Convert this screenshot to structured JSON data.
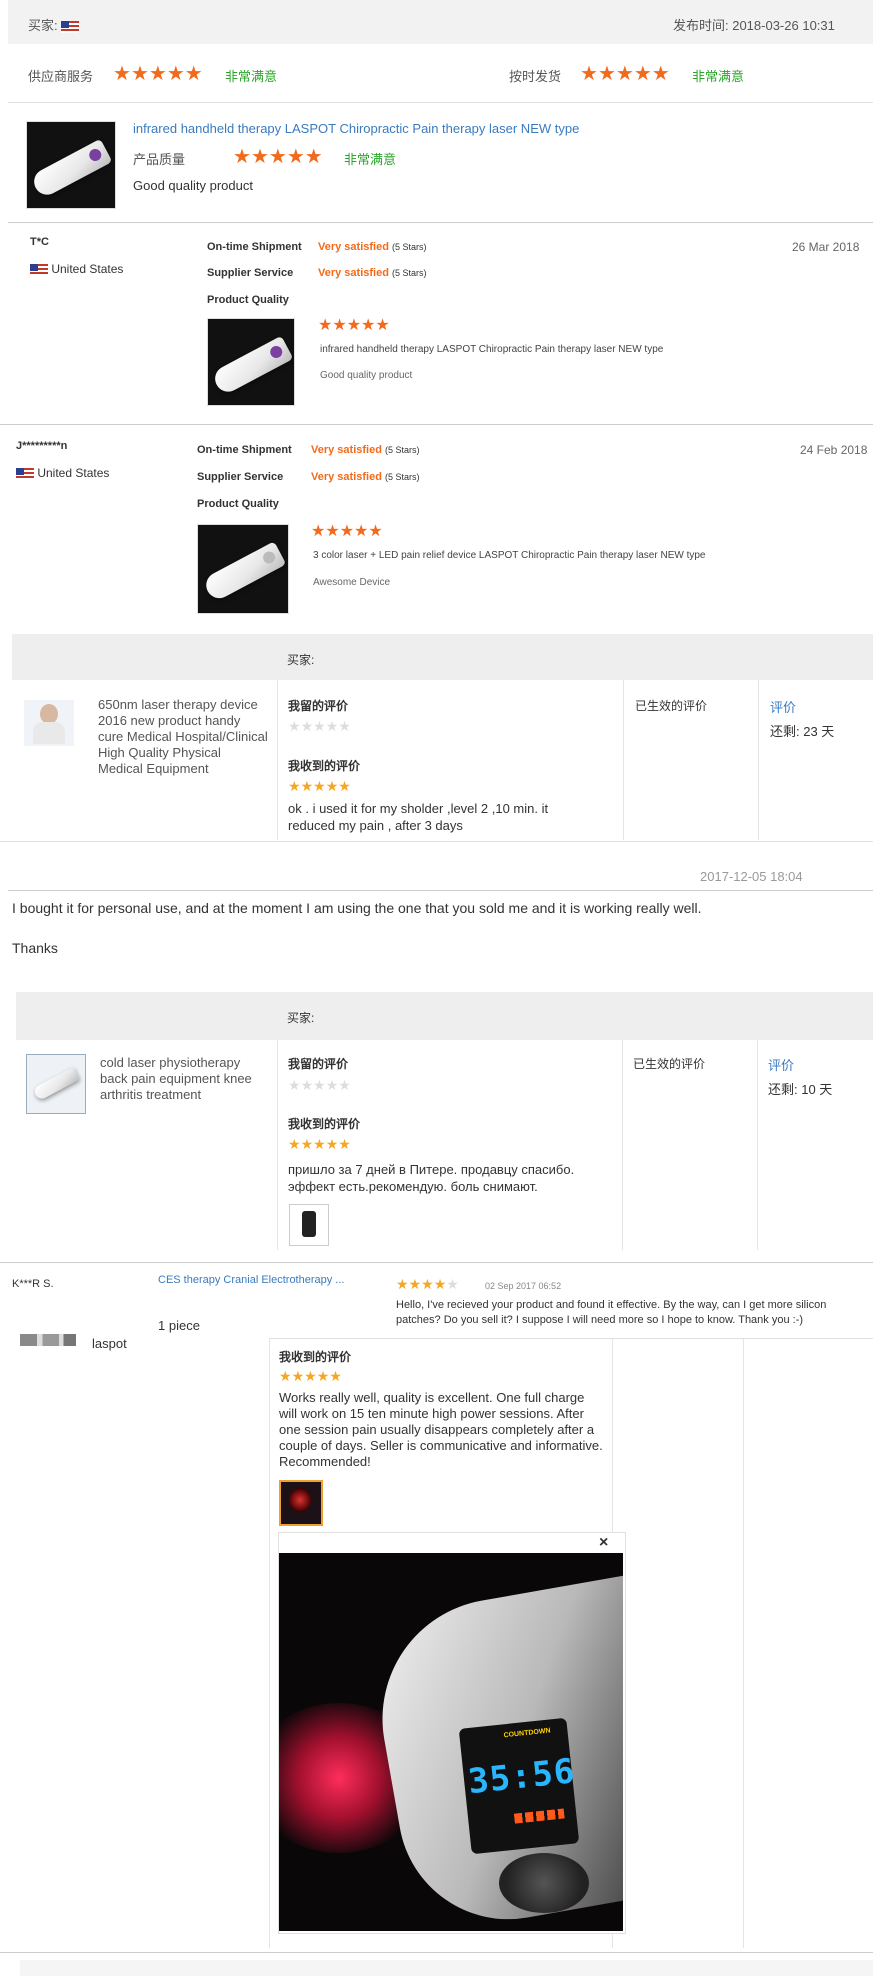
{
  "r1": {
    "buyer_label": "买家:",
    "date": "发布时间: 2018-03-26 10:31",
    "supplier_service": "供应商服务",
    "rating_text": "非常满意",
    "on_time": "按时发货",
    "product_title": "infrared handheld therapy LASPOT Chiropractic Pain therapy laser NEW type",
    "product_quality": "产品质量",
    "comment": "Good quality product"
  },
  "r2": {
    "name": "T*C",
    "country": "United States",
    "date": "26 Mar 2018",
    "on_time_label": "On-time Shipment",
    "supplier_label": "Supplier Service",
    "quality_label": "Product Quality",
    "very_satisfied": "Very satisfied",
    "stars_text": "(5 Stars)",
    "product_title": "infrared handheld therapy LASPOT Chiropractic Pain therapy laser NEW type",
    "comment": "Good quality product"
  },
  "r3": {
    "name": "J*********n",
    "country": "United States",
    "date": "24 Feb 2018",
    "on_time_label": "On-time Shipment",
    "supplier_label": "Supplier Service",
    "quality_label": "Product Quality",
    "very_satisfied": "Very satisfied",
    "stars_text": "(5 Stars)",
    "product_title": "3 color laser + LED pain relief device LASPOT Chiropractic Pain therapy laser NEW type",
    "comment": "Awesome Device"
  },
  "r4": {
    "buyer_label": "买家:",
    "product": "650nm laser therapy device 2016 new product handy cure Medical Hospital/Clinical High Quality Physical Medical Equipment",
    "my_review": "我留的评价",
    "received": "我收到的评价",
    "comment": "ok . i used it for my sholder ,level 2 ,10 min. it reduced my pain , after 3 days",
    "effective": "已生效的评价",
    "review_link": "评价",
    "remaining": "还剩: 23 天"
  },
  "r5": {
    "date": "2017-12-05 18:04",
    "line1": "I bought it for personal use, and at the moment I am using the one that you sold me and it is working really well.",
    "line2": "Thanks"
  },
  "r6": {
    "buyer_label": "买家:",
    "product": "cold laser physiotherapy back pain equipment knee arthritis treatment",
    "my_review": "我留的评价",
    "received": "我收到的评价",
    "comment": "пришло за 7 дней в Питере. продавцу спасибо. эффект есть.рекомендую. боль снимают.",
    "effective": "已生效的评价",
    "review_link": "评价",
    "remaining": "还剩: 10 天"
  },
  "r7": {
    "name": "K***R S.",
    "product_link": "CES therapy Cranial Electrotherapy ...",
    "date": "02 Sep 2017 06:52",
    "message": "Hello, I've recieved your product and found it effective. By the way, can I get more silicon patches? Do you sell it? I suppose I will need more so I hope to know. Thank you :-)",
    "quantity": "1 piece",
    "seller": "laspot",
    "received": "我收到的评价",
    "comment": "Works really well, quality is excellent. One full charge will work on 15 ten minute high power sessions. After one session pain usually disappears completely after a couple of days. Seller is communicative and informative. Recommended!",
    "close": "×",
    "screen_label": "COUNTDOWN",
    "screen_value": "35:56"
  },
  "colors": {
    "star": "#f26a1b",
    "link": "#3a7bbf",
    "green": "#2aa52a"
  }
}
